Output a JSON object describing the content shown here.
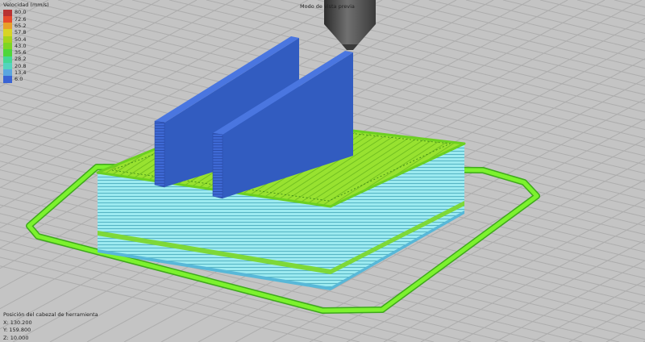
{
  "view_mode_label": "Modo de vista previa",
  "legend": {
    "title": "Velocidad (mm/s)",
    "items": [
      {
        "value": "80.0",
        "color": "#b83232"
      },
      {
        "value": "72.6",
        "color": "#e64a2c"
      },
      {
        "value": "65.2",
        "color": "#e8a02a"
      },
      {
        "value": "57.8",
        "color": "#d8d424"
      },
      {
        "value": "50.4",
        "color": "#a6d41c"
      },
      {
        "value": "43.0",
        "color": "#7ed624"
      },
      {
        "value": "35.6",
        "color": "#4ed63a"
      },
      {
        "value": "28.2",
        "color": "#44d894"
      },
      {
        "value": "20.8",
        "color": "#54d4be"
      },
      {
        "value": "13.4",
        "color": "#5aa6e0"
      },
      {
        "value": "6.0",
        "color": "#3a64d4"
      }
    ]
  },
  "head_position": {
    "title": "Posición del cabezal de herramienta",
    "x": "X: 130.200",
    "y": "Y: 159.800",
    "z": "Z: 10.000"
  },
  "colors": {
    "background": "#c4c4c4",
    "grid": "#b0b0b0",
    "skirt": "#7cf22e",
    "wall": "#9cecee",
    "top": "#94e22e",
    "column": "#3d68d4",
    "nozzle": "#4e4e4e"
  }
}
